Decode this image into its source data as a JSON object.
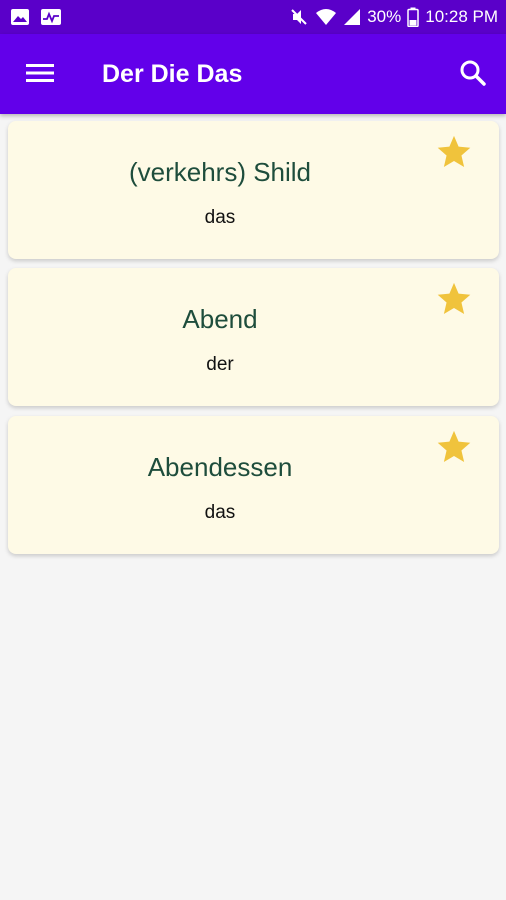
{
  "status_bar": {
    "battery": "30%",
    "time": "10:28 PM"
  },
  "app_bar": {
    "title": "Der Die Das"
  },
  "colors": {
    "app_bar": "#6200ea",
    "status_bar": "#5a00c9",
    "card_bg": "#fefae6",
    "word_text": "#1e4d3c",
    "star": "#f0c33c"
  },
  "cards": [
    {
      "word": "(verkehrs) Shild",
      "article": "das",
      "favorite": true
    },
    {
      "word": "Abend",
      "article": "der",
      "favorite": true
    },
    {
      "word": "Abendessen",
      "article": "das",
      "favorite": true
    }
  ]
}
